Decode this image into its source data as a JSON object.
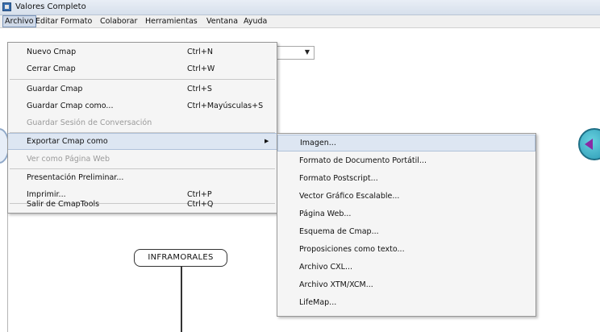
{
  "window": {
    "title": "Valores Completo"
  },
  "menubar": {
    "items": [
      "Archivo",
      "Editar",
      "Formato",
      "Colaborar",
      "Herramientas",
      "Ventana",
      "Ayuda"
    ]
  },
  "file_menu": {
    "items": [
      {
        "label": "Nuevo Cmap",
        "shortcut": "Ctrl+N"
      },
      {
        "label": "Cerrar Cmap",
        "shortcut": "Ctrl+W"
      },
      {
        "label": "Guardar Cmap",
        "shortcut": "Ctrl+S"
      },
      {
        "label": "Guardar Cmap como...",
        "shortcut": "Ctrl+Mayúsculas+S"
      },
      {
        "label": "Guardar Sesión de Conversación",
        "shortcut": ""
      },
      {
        "label": "Exportar Cmap como",
        "shortcut": ""
      },
      {
        "label": "Ver como Página Web",
        "shortcut": ""
      },
      {
        "label": "Presentación Preliminar...",
        "shortcut": ""
      },
      {
        "label": "Imprimir...",
        "shortcut": "Ctrl+P"
      },
      {
        "label": "Salir de CmapTools",
        "shortcut": "Ctrl+Q"
      }
    ]
  },
  "export_submenu": {
    "items": [
      "Imagen...",
      "Formato de Documento Portátil...",
      "Formato Postscript...",
      "Vector Gráfico Escalable...",
      "Página Web...",
      "Esquema de Cmap...",
      "Proposiciones como texto...",
      "Archivo CXL...",
      "Archivo XTM/XCM...",
      "LifeMap..."
    ]
  },
  "canvas": {
    "node_label": "INFRAMORALES"
  },
  "icons": {
    "app": "cmap-app-icon",
    "submenu_arrow": "triangle-right-icon",
    "combo_arrow": "triangle-down-icon",
    "nav": "back-arrow-icon"
  }
}
